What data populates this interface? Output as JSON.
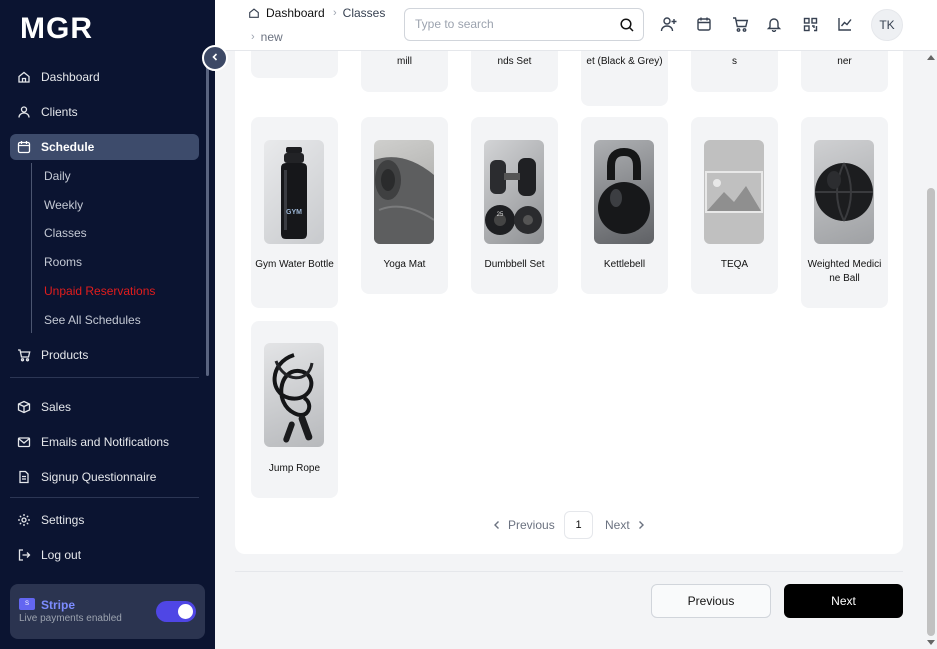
{
  "app": {
    "logo": "MGR"
  },
  "sidebar": {
    "items": [
      {
        "label": "Dashboard",
        "icon": "home-icon"
      },
      {
        "label": "Clients",
        "icon": "user-icon"
      },
      {
        "label": "Schedule",
        "icon": "calendar-icon"
      },
      {
        "label": "Products",
        "icon": "cart-icon"
      },
      {
        "label": "Sales",
        "icon": "box-icon"
      },
      {
        "label": "Emails and Notifications",
        "icon": "mail-icon"
      },
      {
        "label": "Signup Questionnaire",
        "icon": "document-icon"
      },
      {
        "label": "Settings",
        "icon": "gear-icon"
      },
      {
        "label": "Log out",
        "icon": "logout-icon"
      }
    ],
    "schedule_sub": [
      "Daily",
      "Weekly",
      "Classes",
      "Rooms",
      "Unpaid Reservations",
      "See All Schedules"
    ],
    "stripe": {
      "title": "Stripe",
      "subtitle": "Live payments enabled",
      "enabled": true
    }
  },
  "header": {
    "breadcrumb": [
      "Dashboard",
      "Classes",
      "new"
    ],
    "search_placeholder": "Type to search",
    "avatar_initials": "TK"
  },
  "products_partial": [
    "mill",
    "nds Set",
    "et (Black & Grey)",
    "s",
    "ner"
  ],
  "products": [
    {
      "name": "Gym Water Bottle",
      "image": "water-bottle"
    },
    {
      "name": "Yoga Mat",
      "image": "yoga-mat"
    },
    {
      "name": "Dumbbell Set",
      "image": "dumbbells"
    },
    {
      "name": "Kettlebell",
      "image": "kettlebell"
    },
    {
      "name": "TEQA",
      "image": "placeholder"
    },
    {
      "name": "Weighted Medicine Ball",
      "image": "medicine-ball"
    },
    {
      "name": "Jump Rope",
      "image": "jump-rope"
    }
  ],
  "pagination": {
    "previous": "Previous",
    "next": "Next",
    "current": "1"
  },
  "footer": {
    "previous_label": "Previous",
    "next_label": "Next"
  },
  "colors": {
    "sidebar_bg": "#0b1431",
    "active_bg": "#3d4b6b",
    "accent": "#4f46e5",
    "danger": "#e11d1d"
  }
}
